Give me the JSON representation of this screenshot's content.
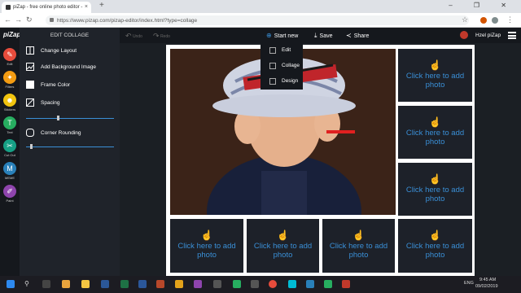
{
  "browser": {
    "tab_title": "piZap - free online photo editor -",
    "tab_close": "×",
    "new_tab": "+",
    "url": "https://www.pizap.com/pizap-editor/index.html?type=collage",
    "window_controls": "– ❐ ✕"
  },
  "app": {
    "logo": "piZap",
    "panel_title": "EDIT COLLAGE",
    "undo_label": "Undo",
    "redo_label": "Redo",
    "start_new_label": "Start new",
    "save_label": "Save",
    "share_label": "Share",
    "username": "Hzel piZap"
  },
  "rail_tools": [
    {
      "label": "Edit",
      "icon": "✎",
      "color": "#e74c3c"
    },
    {
      "label": "Filters",
      "icon": "✦",
      "color": "#f39c12"
    },
    {
      "label": "Stickers",
      "icon": "☻",
      "color": "#f1c40f"
    },
    {
      "label": "Text",
      "icon": "T",
      "color": "#27ae60"
    },
    {
      "label": "Cut Out",
      "icon": "✂",
      "color": "#16a085"
    },
    {
      "label": "MEME",
      "icon": "M",
      "color": "#2980b9"
    },
    {
      "label": "Paint",
      "icon": "✐",
      "color": "#8e44ad"
    }
  ],
  "panel_options": {
    "change_layout": "Change Layout",
    "add_background": "Add Background Image",
    "frame_color": "Frame Color",
    "spacing": "Spacing",
    "corner_rounding": "Corner Rounding"
  },
  "sliders": {
    "spacing_value": 0.35,
    "corner_rounding_value": 0.05
  },
  "dropdown": [
    {
      "label": "Edit"
    },
    {
      "label": "Collage"
    },
    {
      "label": "Design"
    }
  ],
  "cell_text": "Click here to add photo",
  "taskbar": {
    "time": "9:45 AM",
    "date": "09/02/2019",
    "lang": "ENG"
  },
  "colors": {
    "accent": "#3a8fd6",
    "panel": "#1f232a",
    "cell": "#1d2129"
  }
}
